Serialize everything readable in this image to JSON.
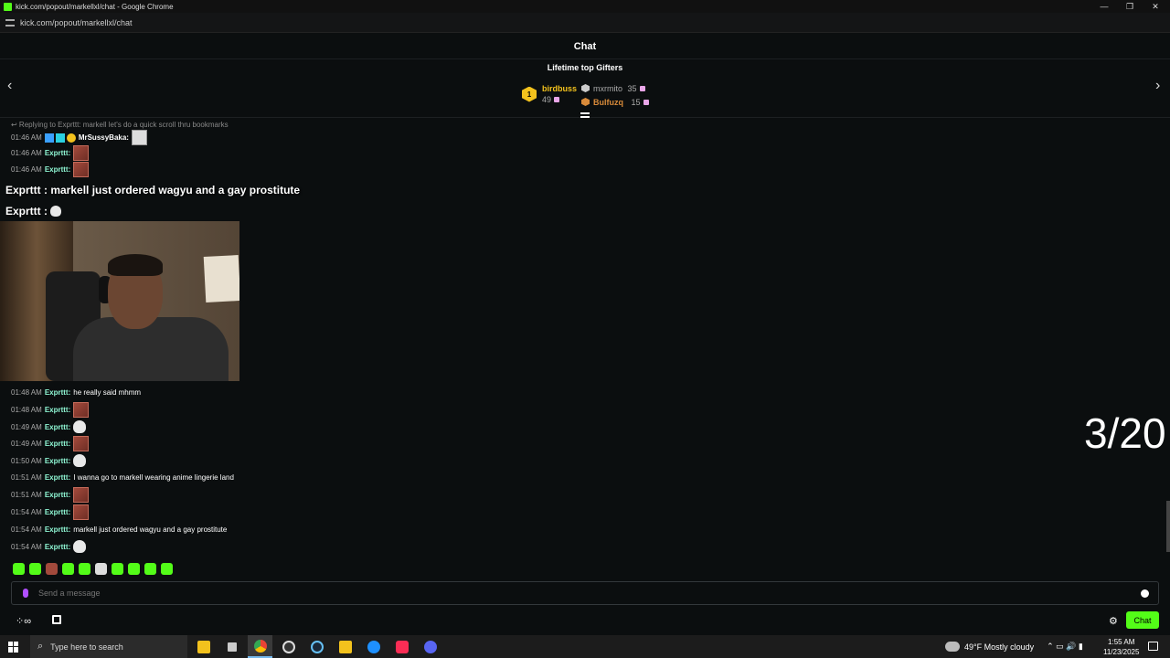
{
  "window": {
    "title": "kick.com/popout/markellxl/chat - Google Chrome",
    "minimize": "—",
    "maximize": "❐",
    "close": "✕"
  },
  "urlbar": {
    "url": "kick.com/popout/markellxl/chat"
  },
  "chat": {
    "header": "Chat",
    "gifters_title": "Lifetime top Gifters",
    "nav_prev": "‹",
    "nav_next": "›",
    "gifters": [
      {
        "rank": "1",
        "name": "birdbuss",
        "count": "49"
      },
      {
        "name": "mxrmito",
        "count": "35"
      },
      {
        "name": "Bulfuzq",
        "count": "15"
      }
    ],
    "reply_text": "↩ Replying to Exprttt: markell let's do a quick scroll thru bookmarks",
    "messages": [
      {
        "time": "01:46 AM",
        "user": "MrSussyBaka:",
        "text": ""
      },
      {
        "time": "01:46 AM",
        "user": "Exprttt:",
        "text": ""
      },
      {
        "time": "01:46 AM",
        "user": "Exprttt:",
        "text": ""
      },
      {
        "time": "01:48 AM",
        "user": "Exprttt:",
        "text": "he really said mhmm"
      },
      {
        "time": "01:48 AM",
        "user": "Exprttt:",
        "text": ""
      },
      {
        "time": "01:49 AM",
        "user": "Exprttt:",
        "text": ""
      },
      {
        "time": "01:49 AM",
        "user": "Exprttt:",
        "text": ""
      },
      {
        "time": "01:50 AM",
        "user": "Exprttt:",
        "text": ""
      },
      {
        "time": "01:51 AM",
        "user": "Exprttt:",
        "text": "I wanna go to markell wearing anime lingerie land"
      },
      {
        "time": "01:51 AM",
        "user": "Exprttt:",
        "text": ""
      },
      {
        "time": "01:54 AM",
        "user": "Exprttt:",
        "text": ""
      },
      {
        "time": "01:54 AM",
        "user": "Exprttt:",
        "text": "markell just ordered wagyu and a gay prostitute"
      },
      {
        "time": "01:54 AM",
        "user": "Exprttt:",
        "text": ""
      }
    ],
    "overlay": {
      "line1": "Exprttt : markell just ordered wagyu and a gay prostitute",
      "line2": "Exprttt :"
    },
    "counter": "3/20",
    "input_placeholder": "Send a message",
    "chat_button": "Chat",
    "users_icon": "⁘∞",
    "gear_icon": "⚙"
  },
  "taskbar": {
    "search_placeholder": "Type here to search",
    "search_icon": "⌕",
    "weather": "49°F  Mostly cloudy",
    "tray_icons": "⌃  ▭  🔊  ▮",
    "time": "1:55 AM",
    "date": "11/23/2025"
  },
  "colors": {
    "accent": "#53fc18",
    "username": "#8ff7d4",
    "gold": "#f3c21d"
  }
}
